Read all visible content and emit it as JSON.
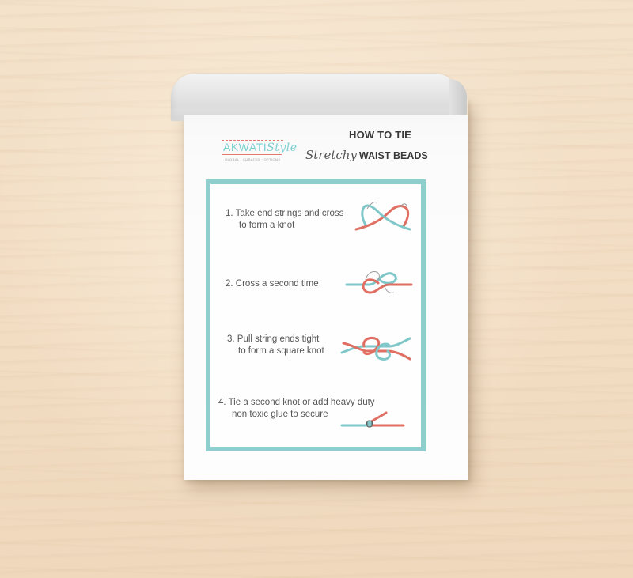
{
  "logo": {
    "brand_main": "AKWATI",
    "brand_script": "Style",
    "tagline": "GLOBAL · CURATED · OPTIONS"
  },
  "title": {
    "line1": "HOW TO TIE",
    "script_word": "Stretchy",
    "line2": "WAIST BEADS"
  },
  "steps": [
    {
      "line1": "1. Take end strings and cross",
      "line2": "to form a knot"
    },
    {
      "line1": "2. Cross a second time",
      "line2": ""
    },
    {
      "line1": "3. Pull string ends tight",
      "line2": "to form a square knot"
    },
    {
      "line1": "4. Tie a second knot or add heavy duty",
      "line2": "non toxic glue to secure"
    }
  ],
  "colors": {
    "frame_teal": "#8ecfcd",
    "string_teal": "#7fc7c8",
    "string_coral": "#e06f63",
    "text_gray": "#555555",
    "background_wood": "#f3dfc6"
  },
  "icons": [
    "knot-step-1-icon",
    "knot-step-2-icon",
    "knot-step-3-icon",
    "knot-step-4-icon"
  ]
}
